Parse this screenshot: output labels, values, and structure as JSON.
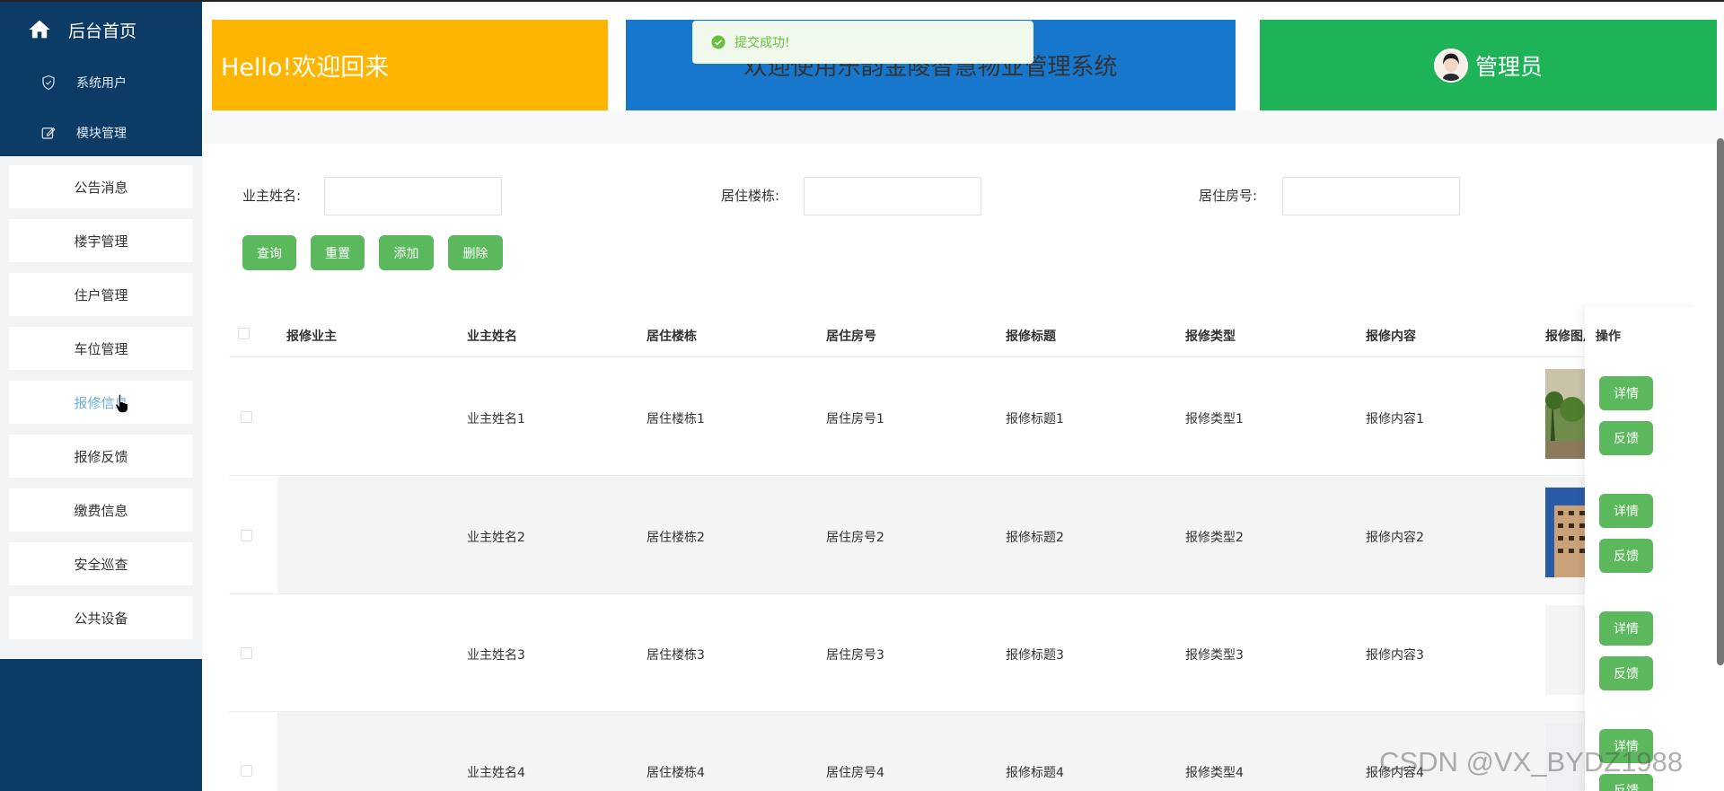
{
  "sidebar": {
    "home_label": "后台首页",
    "system_users": "系统用户",
    "module_management": "模块管理",
    "items": [
      "公告消息",
      "楼宇管理",
      "住户管理",
      "车位管理",
      "报修信息",
      "报修反馈",
      "缴费信息",
      "安全巡查",
      "公共设备"
    ],
    "active_item": "报修信息"
  },
  "header": {
    "welcome": "Hello!欢迎回来",
    "system_title": "欢迎使用乐韵金陵智慧物业管理系统",
    "user_role": "管理员"
  },
  "toast": {
    "message": "提交成功!"
  },
  "search": {
    "owner_name_label": "业主姓名:",
    "building_label": "居住楼栋:",
    "room_label": "居住房号:"
  },
  "buttons": {
    "query": "查询",
    "reset": "重置",
    "add": "添加",
    "delete": "删除"
  },
  "table": {
    "headers": [
      "报修业主",
      "业主姓名",
      "居住楼栋",
      "居住房号",
      "报修标题",
      "报修类型",
      "报修内容",
      "报修图片",
      "操作"
    ],
    "rows": [
      {
        "owner_name": "业主姓名1",
        "building": "居住楼栋1",
        "room": "居住房号1",
        "title": "报修标题1",
        "type": "报修类型1",
        "content": "报修内容1"
      },
      {
        "owner_name": "业主姓名2",
        "building": "居住楼栋2",
        "room": "居住房号2",
        "title": "报修标题2",
        "type": "报修类型2",
        "content": "报修内容2"
      },
      {
        "owner_name": "业主姓名3",
        "building": "居住楼栋3",
        "room": "居住房号3",
        "title": "报修标题3",
        "type": "报修类型3",
        "content": "报修内容3"
      },
      {
        "owner_name": "业主姓名4",
        "building": "居住楼栋4",
        "room": "居住房号4",
        "title": "报修标题4",
        "type": "报修类型4",
        "content": "报修内容4"
      }
    ],
    "detail_label": "详情",
    "feedback_label": "反馈"
  },
  "watermark": "CSDN @VX_BYDZ1988",
  "colors": {
    "sidebar_bg": "#0c3b66",
    "yellow": "#fdb500",
    "blue": "#1677cc",
    "green": "#1db356",
    "button_green": "#5cb85c",
    "active_link": "#6eb0f0"
  }
}
